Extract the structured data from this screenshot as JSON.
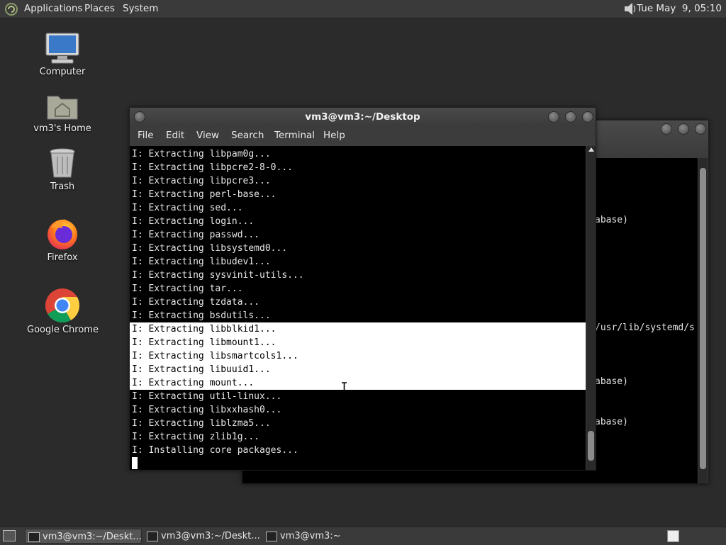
{
  "top_panel": {
    "applications": "Applications",
    "places": "Places",
    "system": "System",
    "clock": "Tue May  9, 05:10"
  },
  "desktop_icons": [
    {
      "label": "Computer",
      "icon": "computer-icon"
    },
    {
      "label": "vm3's Home",
      "icon": "home-folder-icon"
    },
    {
      "label": "Trash",
      "icon": "trash-icon"
    },
    {
      "label": "Firefox",
      "icon": "firefox-icon"
    },
    {
      "label": "Google Chrome",
      "icon": "chrome-icon"
    }
  ],
  "front_window": {
    "title": "vm3@vm3:~/Desktop",
    "menu": [
      "File",
      "Edit",
      "View",
      "Search",
      "Terminal",
      "Help"
    ],
    "lines": [
      "I: Extracting libpam0g...",
      "I: Extracting libpcre2-8-0...",
      "I: Extracting libpcre3...",
      "I: Extracting perl-base...",
      "I: Extracting sed...",
      "I: Extracting login...",
      "I: Extracting passwd...",
      "I: Extracting libsystemd0...",
      "I: Extracting libudev1...",
      "I: Extracting sysvinit-utils...",
      "I: Extracting tar...",
      "I: Extracting tzdata...",
      "I: Extracting bsdutils...",
      "I: Extracting libblkid1...",
      "I: Extracting libmount1...",
      "I: Extracting libsmartcols1...",
      "I: Extracting libuuid1...",
      "I: Extracting mount...",
      "I: Extracting util-linux...",
      "I: Extracting libxxhash0...",
      "I: Extracting liblzma5...",
      "I: Extracting zlib1g...",
      "I: Installing core packages..."
    ],
    "selected_lines": [
      13,
      14,
      15,
      16,
      17
    ]
  },
  "back_window": {
    "fragments": [
      "abase)",
      "/usr/lib/systemd/s",
      "abase)",
      "abase)"
    ]
  },
  "taskbar": {
    "items": [
      {
        "label": "vm3@vm3:~/Deskt...",
        "active": true
      },
      {
        "label": "vm3@vm3:~/Deskt...",
        "active": false
      },
      {
        "label": "vm3@vm3:~",
        "active": false
      }
    ]
  },
  "colors": {
    "panel": "#3a3a3a",
    "desktop": "#2b2b2b",
    "terminal_bg": "#000000",
    "terminal_fg": "#e6e6e6",
    "selection_bg": "#ffffff"
  }
}
